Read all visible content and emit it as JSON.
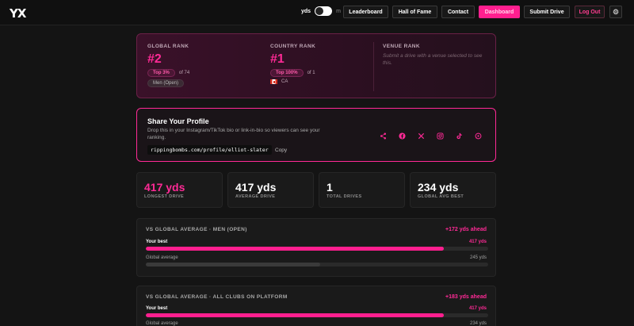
{
  "header": {
    "logo": "YX",
    "unit_active": "yds",
    "unit_inactive": "m",
    "nav": [
      "Leaderboard",
      "Hall of Fame",
      "Contact",
      "Dashboard",
      "Submit Drive",
      "Log Out"
    ],
    "active_nav": "Dashboard",
    "settings_icon": "gear-icon"
  },
  "ranks": {
    "global": {
      "title": "GLOBAL RANK",
      "value": "#2",
      "badge": "Top 3%",
      "of": "of 74",
      "division": "Men (Open)"
    },
    "country": {
      "title": "COUNTRY RANK",
      "value": "#1",
      "badge": "Top 100%",
      "of": "of 1",
      "country_code": "CA"
    },
    "venue": {
      "title": "VENUE RANK",
      "note": "Submit a drive with a venue selected to see this."
    }
  },
  "share": {
    "title": "Share Your Profile",
    "description": "Drop this in your Instagram/TikTok bio or link-in-bio so viewers can see your ranking.",
    "url": "rippingbombs.com/profile/elliot-slater",
    "copy_label": "Copy",
    "icons": [
      "share-icon",
      "facebook-icon",
      "x-icon",
      "instagram-icon",
      "tiktok-icon",
      "whatsapp-icon"
    ]
  },
  "stats": [
    {
      "value": "417 yds",
      "label": "LONGEST DRIVE"
    },
    {
      "value": "417 yds",
      "label": "AVERAGE DRIVE"
    },
    {
      "value": "1",
      "label": "TOTAL DRIVES"
    },
    {
      "value": "234 yds",
      "label": "GLOBAL AVG BEST"
    }
  ],
  "comparisons": [
    {
      "title": "VS GLOBAL AVERAGE · MEN (OPEN)",
      "ahead": "+172 yds ahead",
      "best_label": "Your best",
      "best_value": "417 yds",
      "best_fraction": 0.87,
      "avg_label": "Global average",
      "avg_value": "245 yds",
      "avg_fraction": 0.51
    },
    {
      "title": "VS GLOBAL AVERAGE · ALL CLUBS ON PLATFORM",
      "ahead": "+183 yds ahead",
      "best_label": "Your best",
      "best_value": "417 yds",
      "best_fraction": 0.87,
      "avg_label": "Global average",
      "avg_value": "234 yds",
      "avg_fraction": 0.49
    }
  ],
  "colors": {
    "accent": "#ff1f8f",
    "background": "#141414",
    "card": "#1a1a1a"
  }
}
